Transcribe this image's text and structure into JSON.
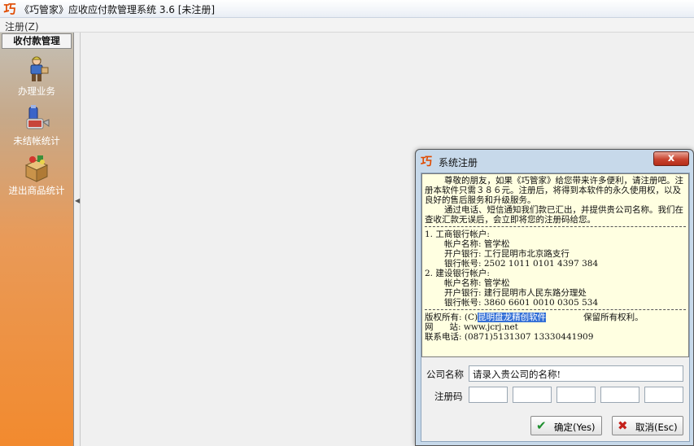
{
  "window": {
    "logo_glyph": "巧",
    "title": "《巧管家》应收应付款管理系统 3.6 [未注册]"
  },
  "menu": {
    "items": [
      {
        "label": "注册(Z)"
      }
    ]
  },
  "sidebar": {
    "header": "收付款管理",
    "items": [
      {
        "label": "办理业务",
        "icon": "worker-icon"
      },
      {
        "label": "未结帐统计",
        "icon": "bottle-pouring-icon"
      },
      {
        "label": "进出商品统计",
        "icon": "goods-box-icon"
      }
    ]
  },
  "dialog": {
    "title": "系统注册",
    "close_glyph": "x",
    "intro": "尊敬的朋友，如果《巧管家》给您带来许多便利，请注册吧。注册本软件只需３８６元。注册后，将得到本软件的永久使用权，以及良好的售后服务和升级服务。",
    "intro2": "通过电话、短信通知我们款已汇出，并提供贵公司名称。我们在查收汇款无误后，会立即将您的注册码给您。",
    "bank1": {
      "heading": "1. 工商银行帐户:",
      "name": "帐户名称: 管学松",
      "branch": "开户银行: 工行昆明市北京路支行",
      "account": "银行帐号: 2502 1011 0101 4397 384"
    },
    "bank2": {
      "heading": "2. 建设银行帐户:",
      "name": "帐户名称: 管学松",
      "branch": "开户银行: 建行昆明市人民东路分理处",
      "account": "银行帐号: 3860 6601 0010 0305 534"
    },
    "copyright_prefix": "版权所有: (C)",
    "copyright_company": "昆明盘龙精创软件",
    "copyright_suffix": "保留所有权利。",
    "website": "网      站: www.jcrj.net",
    "phone": "联系电话: (0871)5131307 13330441909",
    "company_label": "公司名称",
    "company_value": "请录入贵公司的名称!",
    "code_label": "注册码",
    "ok_label": "确定(Yes)",
    "ok_icon": "check-icon",
    "cancel_label": "取消(Esc)",
    "cancel_icon": "x-icon"
  },
  "colors": {
    "sidebar_bottom": "#f28a2e",
    "info_bg": "#ffffe1",
    "highlight": "#3470d6"
  }
}
